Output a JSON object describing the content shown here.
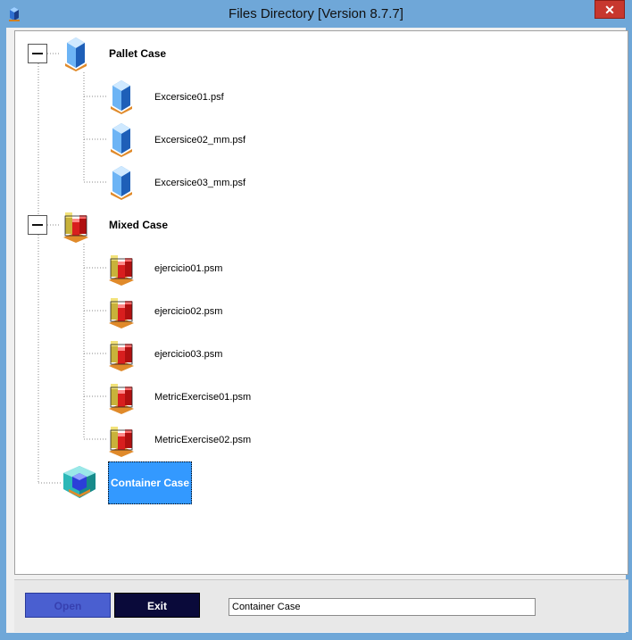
{
  "window": {
    "title": "Files Directory [Version 8.7.7]",
    "close_label": "✕"
  },
  "tree": {
    "groups": [
      {
        "label": "Pallet Case",
        "icon": "pallet-case-icon",
        "expanded": true,
        "files": [
          "Excersice01.psf",
          "Excersice02_mm.psf",
          "Excersice03_mm.psf"
        ]
      },
      {
        "label": "Mixed Case",
        "icon": "mixed-case-icon",
        "expanded": true,
        "files": [
          "ejercicio01.psm",
          "ejercicio02.psm",
          "ejercicio03.psm",
          "MetricExercise01.psm",
          "MetricExercise02.psm"
        ]
      },
      {
        "label": "Container Case",
        "icon": "container-case-icon",
        "selected": true
      }
    ]
  },
  "footer": {
    "open_label": "Open",
    "exit_label": "Exit",
    "selected_value": "Container Case"
  }
}
